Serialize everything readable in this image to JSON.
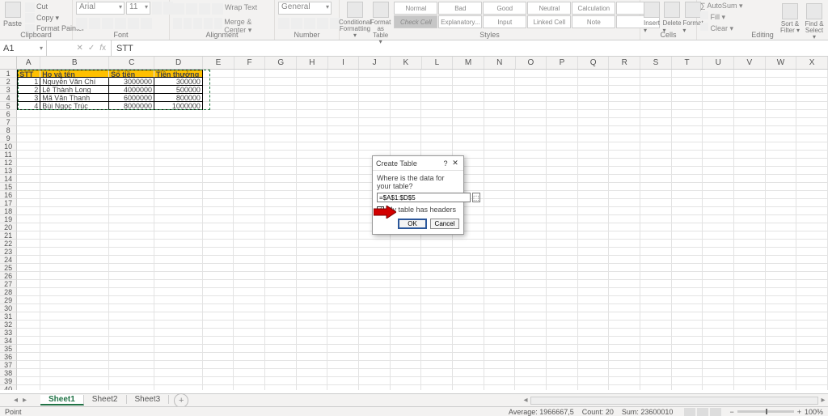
{
  "ribbon": {
    "clipboard": {
      "label": "Clipboard",
      "paste": "Paste",
      "cut": "Cut",
      "copy": "Copy ▾",
      "painter": "Format Painter"
    },
    "font": {
      "label": "Font",
      "name": "Arial",
      "size": "11"
    },
    "alignment": {
      "label": "Alignment",
      "wrap": "Wrap Text",
      "merge": "Merge & Center ▾"
    },
    "number": {
      "label": "Number",
      "format": "General"
    },
    "styles": {
      "label": "Styles",
      "cond": "Conditional Formatting ▾",
      "fmt_table": "Format as Table ▾",
      "gallery": [
        "Normal",
        "Bad",
        "Good",
        "Neutral",
        "Calculation",
        "",
        "Check Cell",
        "Explanatory...",
        "Input",
        "Linked Cell",
        "Note",
        ""
      ]
    },
    "cells": {
      "label": "Cells",
      "insert": "Insert ▾",
      "delete": "Delete ▾",
      "format": "Format ▾"
    },
    "editing": {
      "label": "Editing",
      "autosum": "AutoSum ▾",
      "fill": "Fill ▾",
      "clear": "Clear ▾",
      "sort": "Sort & Filter ▾",
      "find": "Find & Select ▾"
    }
  },
  "namebox": "A1",
  "formula": "STT",
  "columns": {
    "A": 30,
    "B": 88,
    "C": 58,
    "D": 62
  },
  "default_col_width": 40,
  "extra_cols": [
    "E",
    "F",
    "G",
    "H",
    "I",
    "J",
    "K",
    "L",
    "M",
    "N",
    "O",
    "P",
    "Q",
    "R",
    "S",
    "T",
    "U",
    "V",
    "W",
    "X"
  ],
  "row_count": 40,
  "table": {
    "headers": [
      "STT",
      "Họ và tên",
      "Số tiền",
      "Tiền thưởng"
    ],
    "rows": [
      [
        "1",
        "Nguyễn Văn Chí",
        "3000000",
        "300000"
      ],
      [
        "2",
        "Lê Thành Long",
        "4000000",
        "500000"
      ],
      [
        "3",
        "Mã Văn Thanh",
        "6000000",
        "800000"
      ],
      [
        "4",
        "Bùi Ngọc Trúc",
        "8000000",
        "1000000"
      ]
    ]
  },
  "dialog": {
    "title": "Create Table",
    "help": "?",
    "close": "✕",
    "prompt": "Where is the data for your table?",
    "range": "=$A$1:$D$5",
    "headers_chk": "My table has headers",
    "checked": true,
    "ok": "OK",
    "cancel": "Cancel"
  },
  "tabs": {
    "sheets": [
      "Sheet1",
      "Sheet2",
      "Sheet3"
    ],
    "active": 0
  },
  "status": {
    "mode": "Point",
    "average_label": "Average:",
    "average": "1966667,5",
    "count_label": "Count:",
    "count": "20",
    "sum_label": "Sum:",
    "sum": "23600010",
    "zoom": "100%"
  }
}
